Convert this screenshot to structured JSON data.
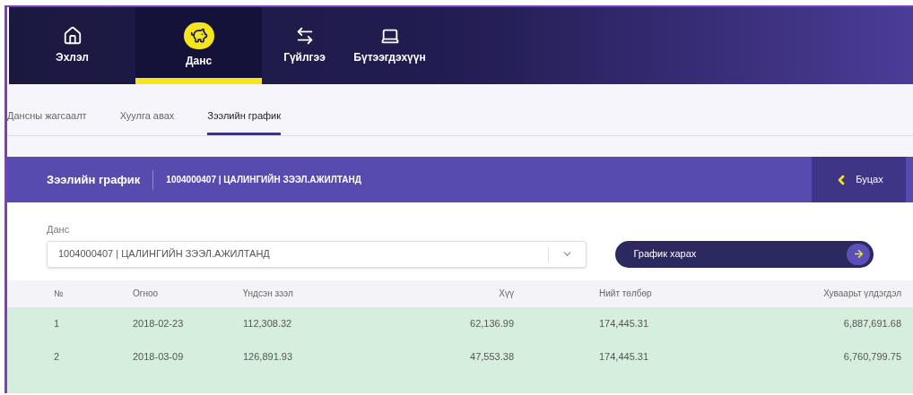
{
  "nav": {
    "items": [
      {
        "label": "Эхлэл",
        "selected": false
      },
      {
        "label": "Данс",
        "selected": true
      },
      {
        "label": "Гүйлгээ",
        "selected": false
      },
      {
        "label": "Бүтээгдэхүүн",
        "selected": false
      }
    ]
  },
  "subtabs": [
    {
      "label": "Дансны жагсаалт",
      "selected": false
    },
    {
      "label": "Хуулга авах",
      "selected": false
    },
    {
      "label": "Зээлийн график",
      "selected": true
    }
  ],
  "header": {
    "title": "Зээлийн график",
    "account": "1004000407 | ЦАЛИНГИЙН ЗЭЭЛ.АЖИЛТАНД",
    "back_button": "Буцах"
  },
  "form": {
    "label": "Данс",
    "value": "1004000407 | ЦАЛИНГИЙН ЗЭЭЛ.АЖИЛТАНД",
    "button": "График харах"
  },
  "table": {
    "columns": [
      "№",
      "Огноо",
      "Үндсэн зээл",
      "Хүү",
      "Нийт төлбөр",
      "Хуваарьт үлдэгдэл"
    ],
    "rows": [
      [
        "1",
        "2018-02-23",
        "112,308.32",
        "62,136.99",
        "174,445.31",
        "6,887,691.68"
      ],
      [
        "2",
        "2018-03-09",
        "126,891.93",
        "47,553.38",
        "174,445.31",
        "6,760,799.75"
      ]
    ]
  }
}
